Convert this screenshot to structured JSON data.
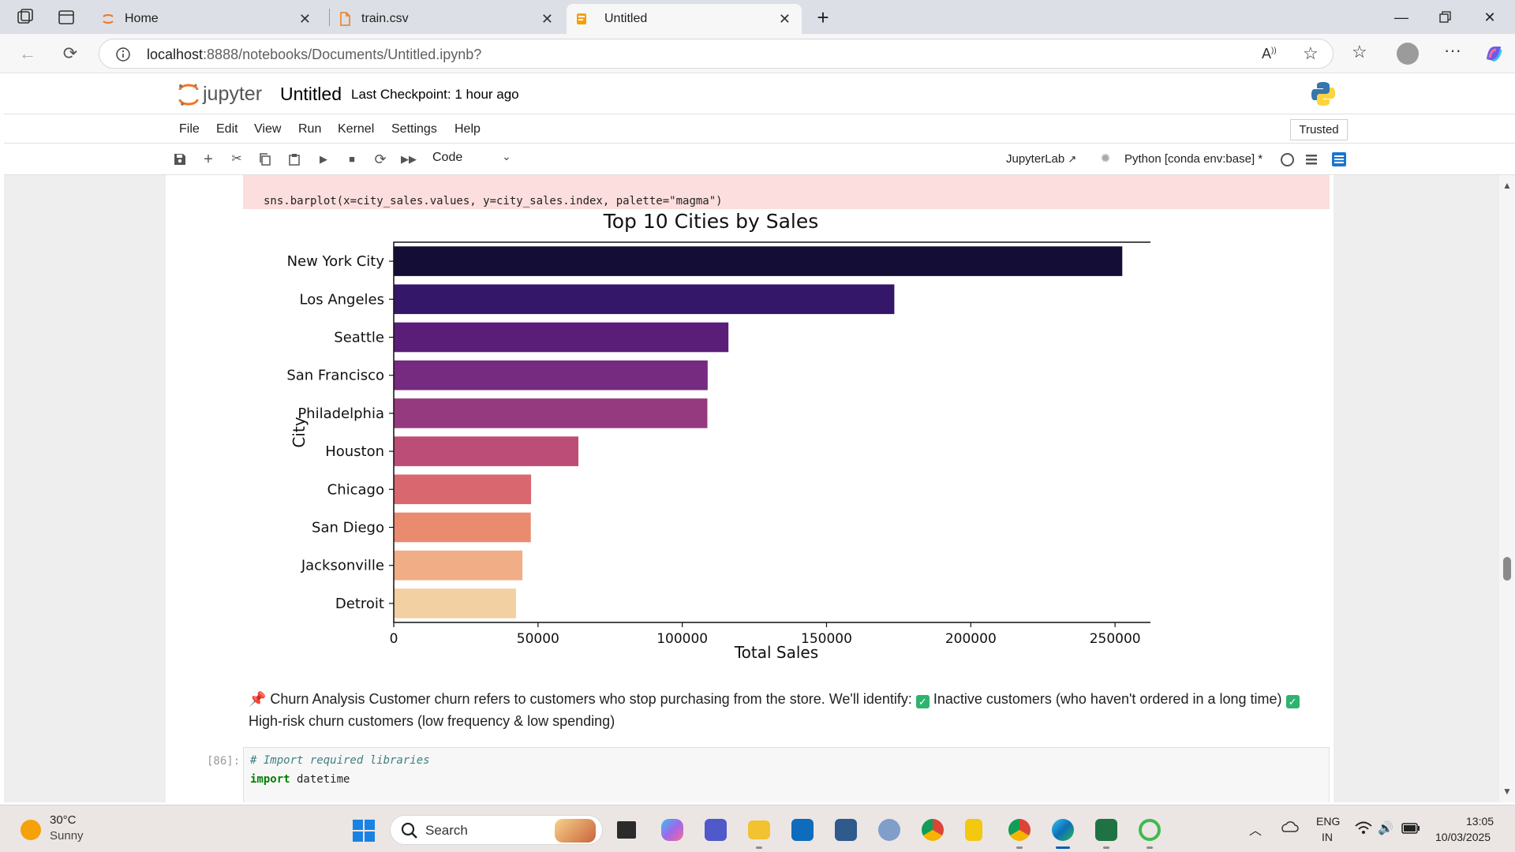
{
  "browser": {
    "tabs": [
      {
        "label": "Home",
        "icon": "jupyter-icon"
      },
      {
        "label": "train.csv",
        "icon": "file-icon"
      },
      {
        "label": "Untitled",
        "icon": "notebook-icon",
        "active": true
      }
    ],
    "url_host": "localhost",
    "url_path": ":8888/notebooks/Documents/Untitled.ipynb?"
  },
  "jupyter": {
    "logo_text": "jupyter",
    "notebook_title": "Untitled",
    "checkpoint": "Last Checkpoint: 1 hour ago",
    "menu": [
      "File",
      "Edit",
      "View",
      "Run",
      "Kernel",
      "Settings",
      "Help"
    ],
    "trusted": "Trusted",
    "cell_type": "Code",
    "jupyterlab_link": "JupyterLab",
    "kernel": "Python [conda env:base] *"
  },
  "cells": {
    "error_code": "sns.barplot(x=city_sales.values, y=city_sales.index, palette=\"magma\")",
    "markdown": {
      "part1": "📌 Churn Analysis Customer churn refers to customers who stop purchasing from the store. We'll identify: ",
      "part2": " Inactive customers (who haven't ordered in a long time) ",
      "part3": " High-risk churn customers (low frequency & low spending)",
      "check_glyph": "✓"
    },
    "code_prompt": "[86]:",
    "code_line1": "# Import required libraries",
    "code_kw": "import",
    "code_mod": " datetime"
  },
  "chart_data": {
    "type": "bar",
    "orientation": "horizontal",
    "title": "Top 10 Cities by Sales",
    "xlabel": "Total Sales",
    "ylabel": "City",
    "categories": [
      "New York City",
      "Los Angeles",
      "Seattle",
      "San Francisco",
      "Philadelphia",
      "Houston",
      "Chicago",
      "San Diego",
      "Jacksonville",
      "Detroit"
    ],
    "values": [
      252500,
      173500,
      116000,
      108800,
      108700,
      64000,
      47600,
      47500,
      44600,
      42400
    ],
    "xlim": [
      0,
      265000
    ],
    "xticks": [
      0,
      50000,
      100000,
      150000,
      200000,
      250000
    ],
    "palette": [
      "#140e36",
      "#341769",
      "#5a1d78",
      "#762a80",
      "#963a7f",
      "#bb4d76",
      "#d9676f",
      "#ea8a6f",
      "#f0ad86",
      "#f3d0a1"
    ],
    "grid": false
  },
  "taskbar": {
    "temp": "30°C",
    "weather": "Sunny",
    "search": "Search",
    "lang1": "ENG",
    "lang2": "IN",
    "time": "13:05",
    "date": "10/03/2025"
  }
}
